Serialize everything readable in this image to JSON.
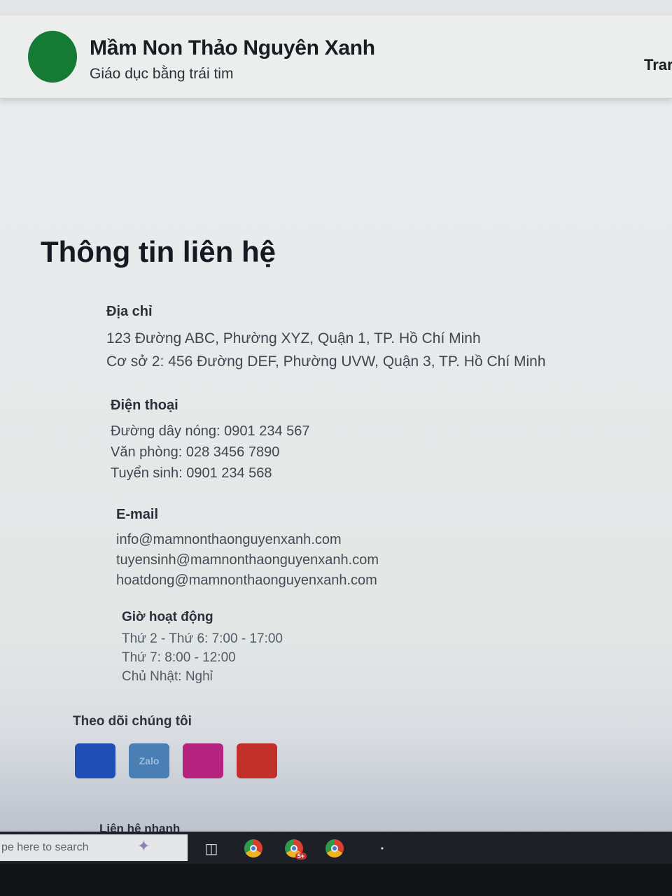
{
  "header": {
    "brand_name": "Mầm Non Thảo Nguyên Xanh",
    "tagline": "Giáo dục bằng trái tim",
    "nav_partial": "Trar"
  },
  "colors": {
    "logo": "#157a34",
    "facebook": "#1f4fb5",
    "zalo": "#4a7fb5",
    "instagram": "#b5237f",
    "youtube": "#c2302a"
  },
  "contact": {
    "title": "Thông tin liên hệ",
    "address": {
      "heading": "Địa chỉ",
      "lines": [
        "123 Đường ABC, Phường XYZ, Quận 1, TP. Hồ Chí Minh",
        "Cơ sở 2: 456 Đường DEF, Phường UVW, Quận 3, TP. Hồ Chí Minh"
      ]
    },
    "phone": {
      "heading": "Điện thoại",
      "lines": [
        "Đường dây nóng: 0901 234 567",
        "Văn phòng: 028 3456 7890",
        "Tuyển sinh: 0901 234 568"
      ]
    },
    "email": {
      "heading": "E-mail",
      "lines": [
        "info@mamnonthaonguyenxanh.com",
        "tuyensinh@mamnonthaonguyenxanh.com",
        "hoatdong@mamnonthaonguyenxanh.com"
      ]
    },
    "hours": {
      "heading": "Giờ hoạt động",
      "lines": [
        "Thứ 2 - Thứ 6: 7:00 - 17:00",
        "Thứ 7: 8:00 - 12:00",
        "Chủ Nhật: Nghỉ"
      ]
    }
  },
  "social": {
    "heading": "Theo dõi chúng tôi",
    "zalo_label": "Zalo",
    "icons": [
      "facebook-icon",
      "zalo-icon",
      "instagram-icon",
      "youtube-icon"
    ]
  },
  "quick_contact": {
    "heading": "Liên hệ nhanh"
  },
  "taskbar": {
    "search_placeholder": "pe here to search",
    "chrome_badge": "5+"
  }
}
